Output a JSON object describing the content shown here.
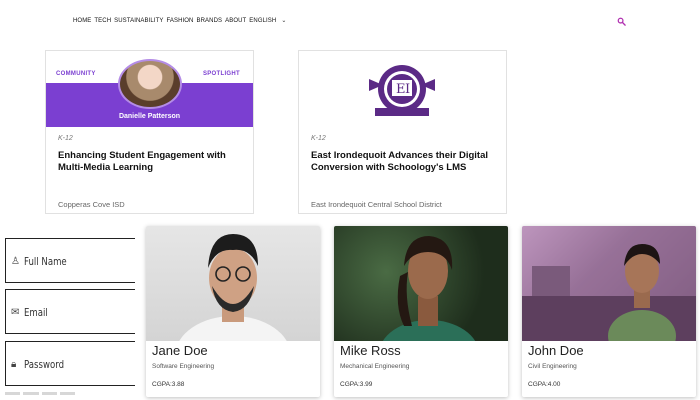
{
  "nav": {
    "items": [
      "HOME",
      "TECH",
      "SUSTAINABILITY",
      "FASHION",
      "BRANDS",
      "ABOUT",
      "ENGLISH"
    ],
    "caret": "⌄"
  },
  "colors": {
    "accent": "#7b3fd1",
    "search": "#b02fb0"
  },
  "articles": [
    {
      "thumb_top_left": "COMMUNITY",
      "thumb_top_right": "SPOTLIGHT",
      "thumb_name": "Danielle Patterson",
      "category": "K-12",
      "title": "Enhancing Student Engagement with Multi-Media Learning",
      "source": "Copperas Cove ISD"
    },
    {
      "category": "K-12",
      "title": "East Irondequoit Advances their Digital Conversion with Schoology's LMS",
      "source": "East Irondequoit Central School District"
    }
  ],
  "form": {
    "full_name_placeholder": "Full Name",
    "email_placeholder": "Email",
    "password_placeholder": "Password"
  },
  "profiles": [
    {
      "name": "Jane Doe",
      "major": "Software Engineering",
      "cgpa": "CGPA:3.88"
    },
    {
      "name": "Mike Ross",
      "major": "Mechanical Engineering",
      "cgpa": "CGPA:3.99"
    },
    {
      "name": "John Doe",
      "major": "Civil Engineering",
      "cgpa": "CGPA:4.00"
    }
  ]
}
